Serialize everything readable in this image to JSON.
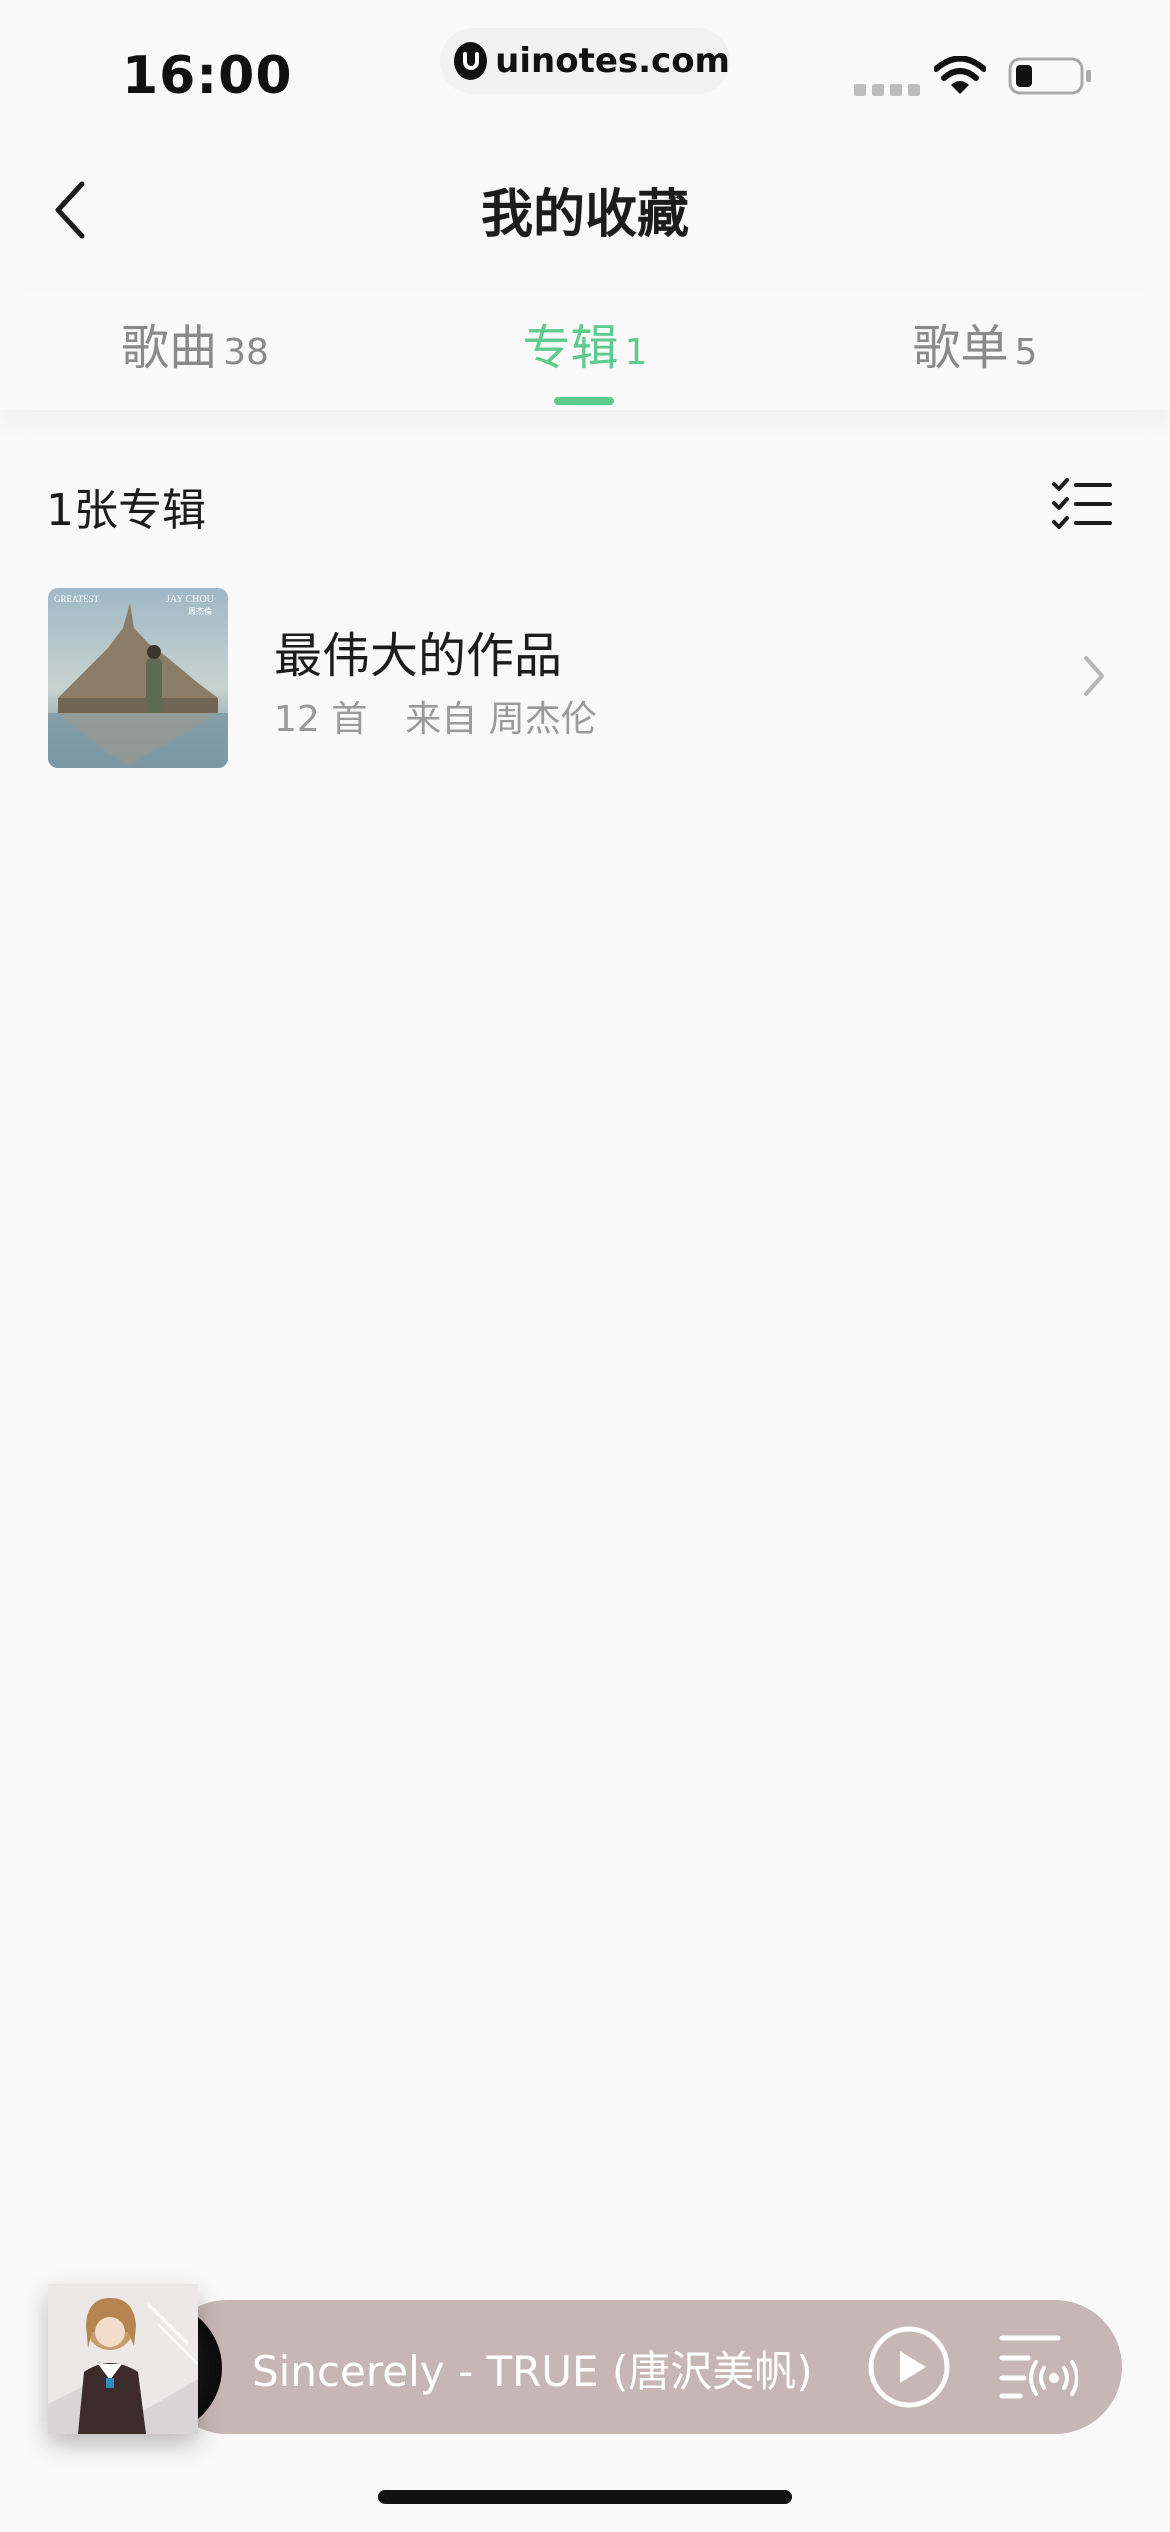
{
  "status_bar": {
    "time": "16:00",
    "url": "uinotes.com"
  },
  "header": {
    "title": "我的收藏",
    "back_icon": "chevron-left-icon"
  },
  "tabs": [
    {
      "label": "歌曲",
      "count": "38",
      "active": false
    },
    {
      "label": "专辑",
      "count": "1",
      "active": true
    },
    {
      "label": "歌单",
      "count": "5",
      "active": false
    }
  ],
  "list": {
    "summary": "1张专辑",
    "multiselect_icon": "checklist-icon",
    "albums": [
      {
        "title": "最伟大的作品",
        "track_count": "12 首",
        "source": "来自 周杰伦",
        "cover_text_left": "GREATEST",
        "cover_text_right": "JAY CHOU",
        "cover_text_sub": "周杰倫"
      }
    ]
  },
  "player": {
    "now_playing": "Sincerely - TRUE (唐沢美帆)",
    "play_icon": "play-icon",
    "playlist_icon": "playlist-icon"
  },
  "colors": {
    "accent": "#5ccb8c",
    "player_bar": "#c7b7b4",
    "background": "#f9f9f9"
  }
}
